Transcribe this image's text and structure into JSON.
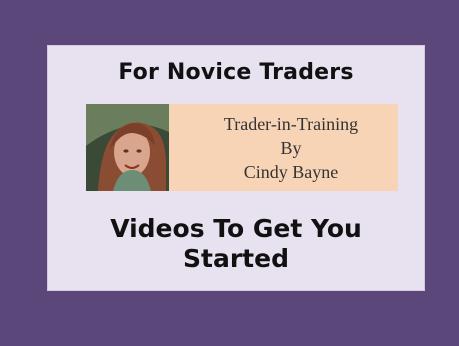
{
  "card": {
    "heading": "For Novice Traders",
    "banner": {
      "line1": "Trader-in-Training",
      "line2": "By",
      "line3": "Cindy Bayne"
    },
    "subheading_line1": "Videos To Get You",
    "subheading_line2": "Started"
  },
  "colors": {
    "frame": "#5c477a",
    "card": "#e8e1ef",
    "banner": "#f7d4b6"
  }
}
